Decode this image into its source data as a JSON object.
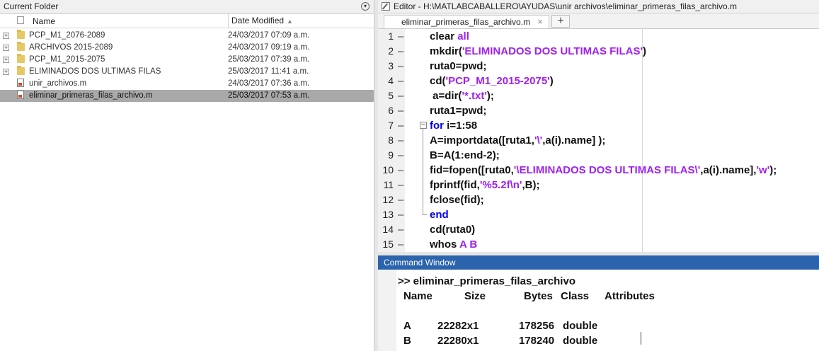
{
  "current_folder": {
    "title": "Current Folder",
    "columns": {
      "name": "Name",
      "date": "Date Modified"
    },
    "items": [
      {
        "type": "folder",
        "name": "PCP_M1_2076-2089",
        "date": "24/03/2017 07:09 a.m.",
        "selected": false
      },
      {
        "type": "folder",
        "name": "ARCHIVOS  2015-2089",
        "date": "24/03/2017 09:19 a.m.",
        "selected": false
      },
      {
        "type": "folder",
        "name": "PCP_M1_2015-2075",
        "date": "25/03/2017 07:39 a.m.",
        "selected": false
      },
      {
        "type": "folder",
        "name": "ELIMINADOS DOS ULTIMAS FILAS",
        "date": "25/03/2017 11:41 a.m.",
        "selected": false
      },
      {
        "type": "mfile",
        "name": "unir_archivos.m",
        "date": "24/03/2017 07:36 a.m.",
        "selected": false
      },
      {
        "type": "mfile",
        "name": "eliminar_primeras_filas_archivo.m",
        "date": "25/03/2017 07:53 a.m.",
        "selected": true
      }
    ]
  },
  "editor": {
    "title": "Editor - H:\\MATLABCABALLERO\\AYUDAS\\unir archivos\\eliminar_primeras_filas_archivo.m",
    "tab_label": "eliminar_primeras_filas_archivo.m",
    "close_symbol": "×",
    "plus_symbol": "+",
    "lines": [
      {
        "n": "1",
        "indent": 1,
        "parts": [
          [
            "t",
            "clear "
          ],
          [
            "s",
            "all"
          ]
        ]
      },
      {
        "n": "2",
        "indent": 1,
        "parts": [
          [
            "t",
            "mkdir("
          ],
          [
            "s",
            "'ELIMINADOS DOS ULTIMAS FILAS'"
          ],
          [
            "t",
            ")"
          ]
        ]
      },
      {
        "n": "3",
        "indent": 1,
        "parts": [
          [
            "t",
            "ruta0=pwd;"
          ]
        ]
      },
      {
        "n": "4",
        "indent": 1,
        "parts": [
          [
            "t",
            "cd("
          ],
          [
            "s",
            "'PCP_M1_2015-2075'"
          ],
          [
            "t",
            ")"
          ]
        ]
      },
      {
        "n": "5",
        "indent": 1,
        "parts": [
          [
            "t",
            " a=dir("
          ],
          [
            "s",
            "'*.txt'"
          ],
          [
            "t",
            ");"
          ]
        ]
      },
      {
        "n": "6",
        "indent": 1,
        "parts": [
          [
            "t",
            "ruta1=pwd;"
          ]
        ]
      },
      {
        "n": "7",
        "indent": 1,
        "parts": [
          [
            "k",
            "for "
          ],
          [
            "t",
            "i=1:58"
          ]
        ]
      },
      {
        "n": "8",
        "indent": 1,
        "parts": [
          [
            "t",
            "A=importdata([ruta1,"
          ],
          [
            "s",
            "'\\'"
          ],
          [
            "t",
            ",a(i).name] );"
          ]
        ]
      },
      {
        "n": "9",
        "indent": 1,
        "parts": [
          [
            "t",
            "B=A(1:end-2);"
          ]
        ]
      },
      {
        "n": "10",
        "indent": 1,
        "parts": [
          [
            "t",
            "fid=fopen([ruta0,"
          ],
          [
            "s",
            "'\\ELIMINADOS DOS ULTIMAS FILAS\\'"
          ],
          [
            "t",
            ",a(i).name],"
          ],
          [
            "s",
            "'w'"
          ],
          [
            "t",
            ");"
          ]
        ]
      },
      {
        "n": "11",
        "indent": 1,
        "parts": [
          [
            "t",
            "fprintf(fid,"
          ],
          [
            "s",
            "'%5.2f\\n'"
          ],
          [
            "t",
            ",B);"
          ]
        ]
      },
      {
        "n": "12",
        "indent": 1,
        "parts": [
          [
            "t",
            "fclose(fid);"
          ]
        ]
      },
      {
        "n": "13",
        "indent": 1,
        "parts": [
          [
            "k",
            "end"
          ]
        ]
      },
      {
        "n": "14",
        "indent": 1,
        "parts": [
          [
            "t",
            "cd(ruta0)"
          ]
        ]
      },
      {
        "n": "15",
        "indent": 1,
        "parts": [
          [
            "t",
            "whos "
          ],
          [
            "s",
            "A B"
          ]
        ]
      }
    ]
  },
  "command_window": {
    "title": "Command Window",
    "prompt_line": ">> eliminar_primeras_filas_archivo",
    "header": {
      "name": "Name",
      "size": "Size",
      "bytes": "Bytes",
      "class": "Class",
      "attributes": "Attributes"
    },
    "rows": [
      {
        "name": "A",
        "size": "22282x1",
        "bytes": "178256",
        "class": "double"
      },
      {
        "name": "B",
        "size": "22280x1",
        "bytes": "178240",
        "class": "double"
      }
    ]
  }
}
